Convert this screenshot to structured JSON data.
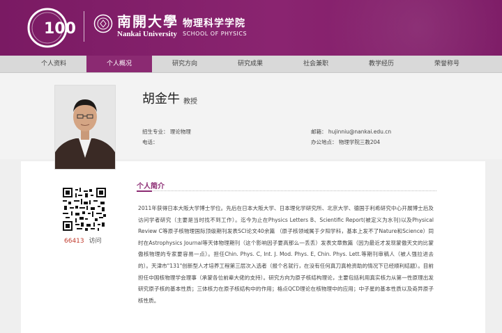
{
  "header": {
    "anniversary_logo": "100",
    "university_cn": "南開大學",
    "university_en": "Nankai University",
    "school_cn": "物理科学学院",
    "school_en": "SCHOOL OF PHYSICS",
    "brand_color": "#7a1a63"
  },
  "nav": {
    "items": [
      "个人资料",
      "个人概况",
      "研究方向",
      "研究成果",
      "社会兼职",
      "教学经历",
      "荣誉称号"
    ],
    "active_index": 1
  },
  "profile": {
    "name": "胡金牛",
    "title": "教授",
    "major_label": "招生专业：",
    "major": "理论物理",
    "phone_label": "电话：",
    "phone": "",
    "email_label": "邮箱：",
    "email": "hujinniu@nankai.edu.cn",
    "office_label": "办公地点：",
    "office": "物理学院三教204"
  },
  "sidebar": {
    "visit_count": "66413",
    "visit_label": "访问"
  },
  "section": {
    "title": "个人简介",
    "bio": "2011年获得日本大阪大学博士学位。先后在日本大阪大学、日本理化学研究所、北京大学、德国于利希研究中心开展博士后及访问学者研究（主要是当时找不到工作）。迄今为止在Physics Letters B、Scientific Report(被定义为水刊)以及Physical Review C等原子核物理国际顶级期刊发表SCI论文40余篇 （原子核领域属于夕阳学科，基本上发不了Nature和Science）同时在Astrophysics Journal等天体物理期刊（这个影响因子要高那么一丢丢）发表文章数篇（因为最近才发现蒙傲天文的比蒙傲核物理的专家要容易一点）。担任Chin. Phys. C, Int. J. Mod. Phys. E, Chin. Phys. Lett.等期刊审稿人（被人强拉进去的）。天津市\"131\"创新型人才培养工程第三层次入选者（报个名就行，在没有任何真刀真枪资助的情况下已经顺利结题）。目前担任中国核物理学会理事（承蒙各位前辈大佬的支持）。研究方向为原子核结构理论，主要包括利用真实核力从第一性原理出发研究原子核的基本性质；三体核力在原子核结构中的作用；格点QCD理论在核物理中的应用；中子星的基本性质以及奇异原子核性质。"
  }
}
